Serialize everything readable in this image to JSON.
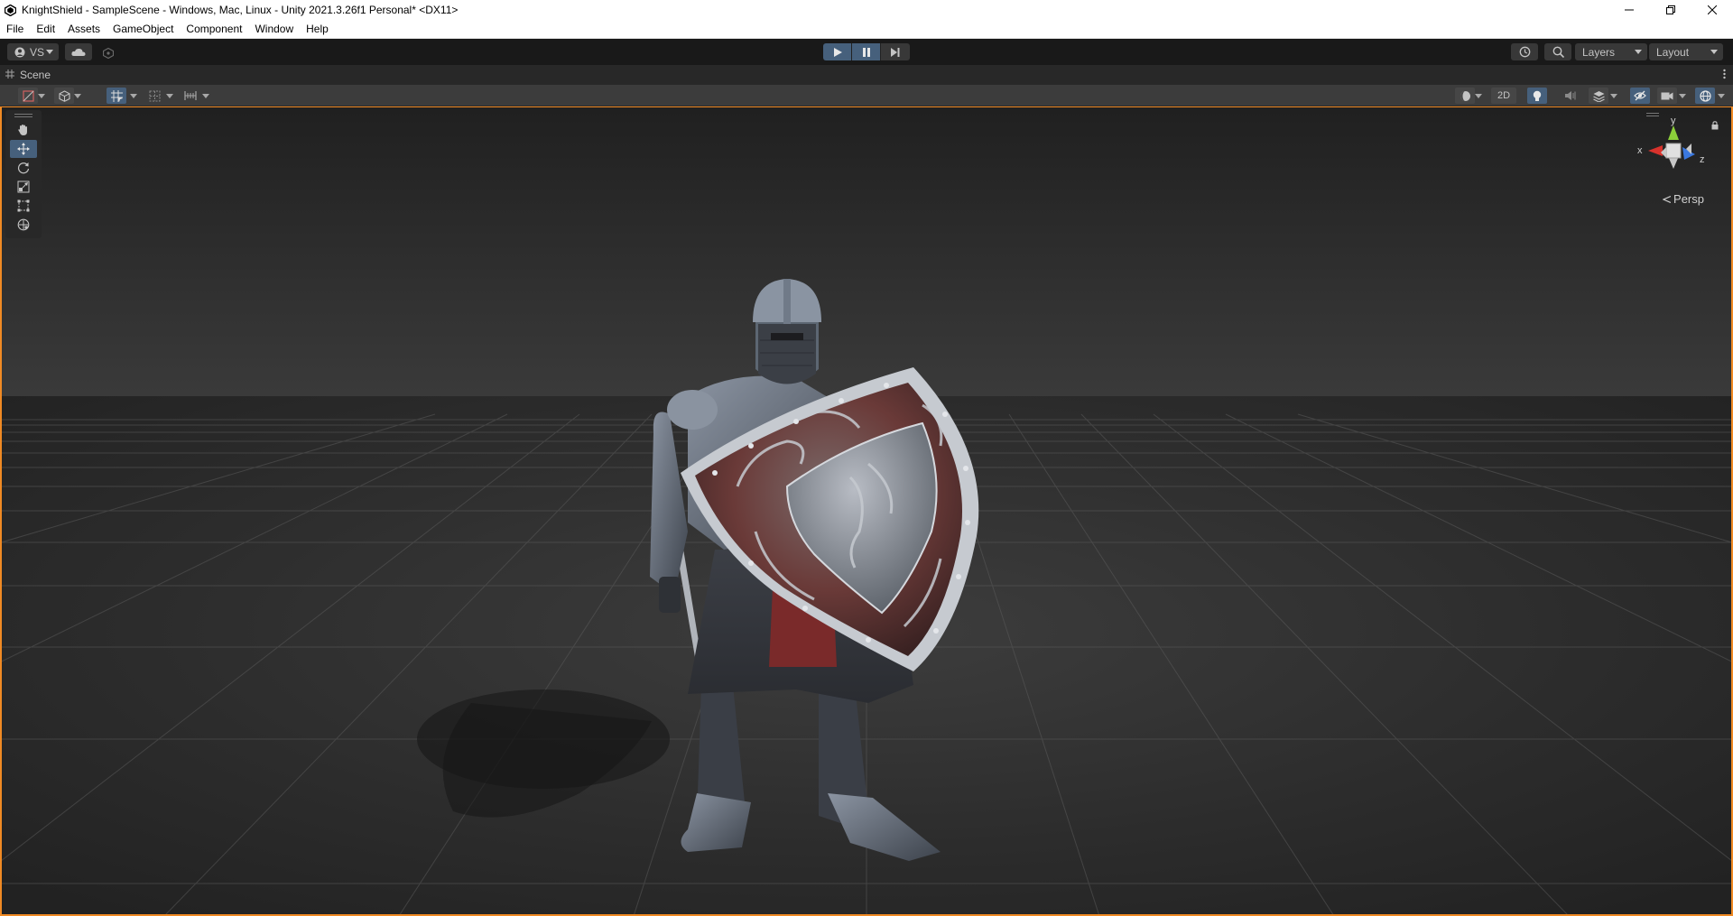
{
  "window": {
    "title": "KnightShield - SampleScene - Windows, Mac, Linux - Unity 2021.3.26f1 Personal* <DX11>",
    "controls": [
      "minimize-icon",
      "restore-icon",
      "close-icon"
    ]
  },
  "menu": {
    "items": [
      "File",
      "Edit",
      "Assets",
      "GameObject",
      "Component",
      "Window",
      "Help"
    ]
  },
  "toolbar": {
    "account_label": "VS",
    "layers_label": "Layers",
    "layout_label": "Layout"
  },
  "scene_tab": {
    "label": "Scene"
  },
  "scene_toolbar": {
    "mode_2d_label": "2D"
  },
  "gizmo": {
    "y_label": "y",
    "x_label": "x",
    "z_label": "z",
    "projection_label": "Persp"
  },
  "colors": {
    "accent_orange": "#f08a24",
    "active_blue": "#46607c",
    "panel_dark": "#191919",
    "axis_x": "#d8322c",
    "axis_y": "#8ccf3a",
    "axis_z": "#3a78e0"
  }
}
